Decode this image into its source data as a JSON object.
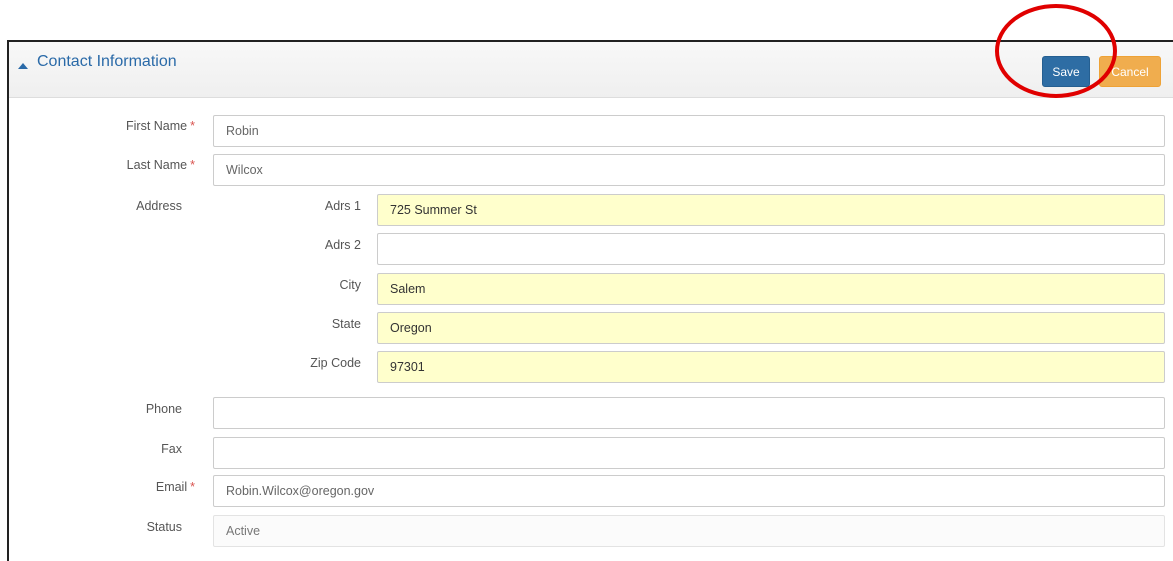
{
  "panel": {
    "title": "Contact Information",
    "save_label": "Save",
    "cancel_label": "Cancel"
  },
  "form": {
    "first_name": {
      "label": "First Name",
      "required": "*",
      "value": "Robin"
    },
    "last_name": {
      "label": "Last Name",
      "required": "*",
      "value": "Wilcox"
    },
    "address": {
      "label": "Address",
      "adrs1": {
        "label": "Adrs 1",
        "value": "725 Summer St"
      },
      "adrs2": {
        "label": "Adrs 2",
        "value": ""
      },
      "city": {
        "label": "City",
        "value": "Salem"
      },
      "state": {
        "label": "State",
        "value": "Oregon"
      },
      "zip": {
        "label": "Zip Code",
        "value": "97301"
      }
    },
    "phone": {
      "label": "Phone",
      "value": ""
    },
    "fax": {
      "label": "Fax",
      "value": ""
    },
    "email": {
      "label": "Email",
      "required": "*",
      "value": "Robin.Wilcox@oregon.gov"
    },
    "status": {
      "label": "Status",
      "value": "Active"
    }
  },
  "colors": {
    "title": "#2a6aa8",
    "save_button": "#2e6da4",
    "cancel_button": "#f0ad4e",
    "required_marker": "#d9534f",
    "autofill_background": "#ffffcc",
    "highlight_circle": "#e00000"
  },
  "icons": {
    "collapse": "caret-up-icon"
  }
}
